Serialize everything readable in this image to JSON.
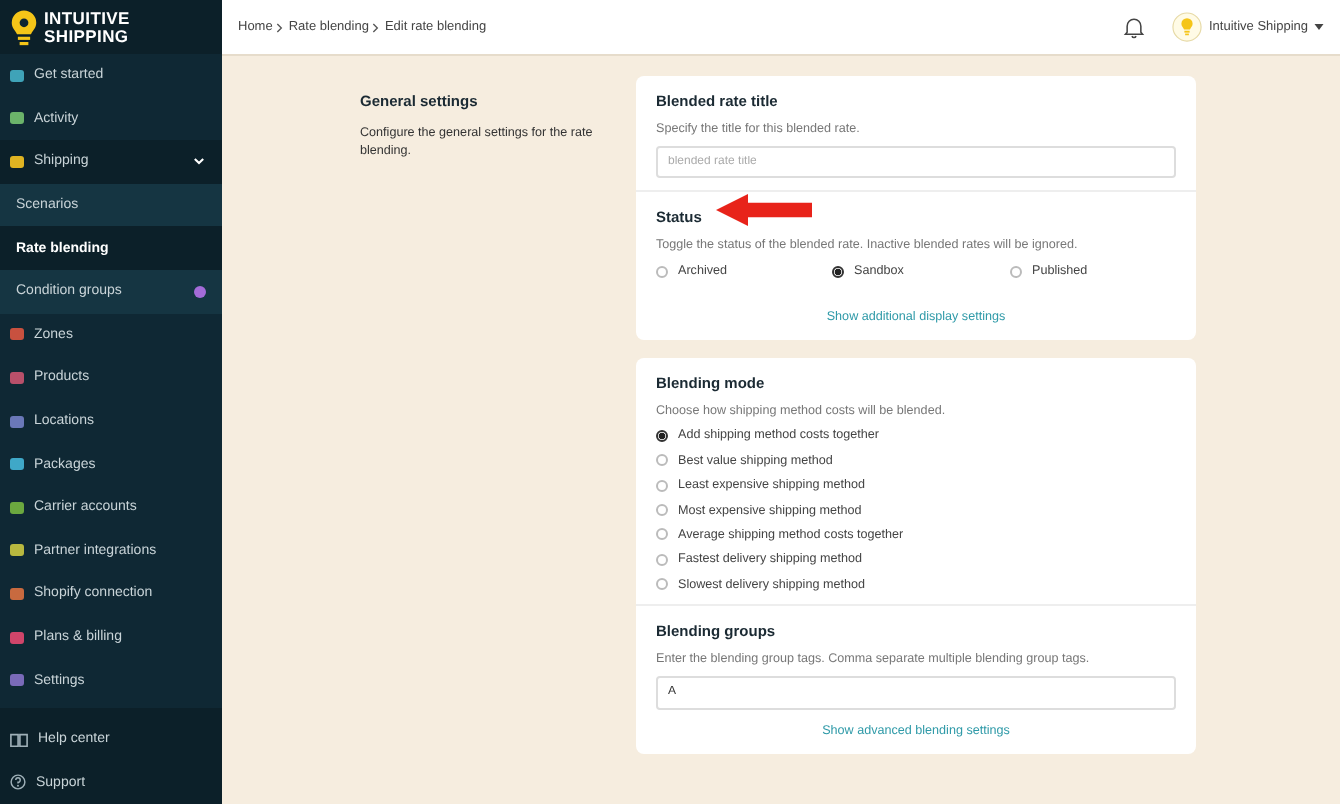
{
  "sidebar": {
    "logo": [
      "INTUITIVE",
      "SHIPPING"
    ],
    "items": [
      {
        "label": "Get started",
        "color": "#3fa3b8",
        "selected": false
      },
      {
        "label": "Activity",
        "color": "#6bb36a",
        "selected": false
      },
      {
        "label": "Shipping",
        "color": "#e0b422",
        "selected": false,
        "expanded": true,
        "children": [
          {
            "label": "Scenarios",
            "selected": false,
            "badge": false
          },
          {
            "label": "Rate blending",
            "selected": true,
            "badge": false
          },
          {
            "label": "Condition groups",
            "selected": false,
            "badge": true
          }
        ]
      },
      {
        "label": "Zones",
        "color": "#c8513f",
        "selected": false
      },
      {
        "label": "Products",
        "color": "#b8506a",
        "selected": false
      },
      {
        "label": "Locations",
        "color": "#6a78b8",
        "selected": false
      },
      {
        "label": "Packages",
        "color": "#3fa8c8",
        "selected": false
      },
      {
        "label": "Carrier accounts",
        "color": "#6ba83f",
        "selected": false
      },
      {
        "label": "Partner integrations",
        "color": "#b8b83f",
        "selected": false
      },
      {
        "label": "Shopify connection",
        "color": "#c86a3f",
        "selected": false
      },
      {
        "label": "Plans & billing",
        "color": "#d0456a",
        "selected": false
      },
      {
        "label": "Settings",
        "color": "#7a6ab8",
        "selected": false
      }
    ],
    "footer_items": [
      {
        "label": "Help center",
        "selected": false
      },
      {
        "label": "Support",
        "selected": false
      }
    ]
  },
  "breadcrumb": [
    "Home",
    "Rate blending",
    "Edit rate blending"
  ],
  "account": {
    "name": "Intuitive Shipping"
  },
  "section": {
    "title": "General settings",
    "description": "Configure the general settings for the rate blending."
  },
  "card1": {
    "title_field": {
      "title": "Blended rate title",
      "description": "Specify the title for this blended rate.",
      "placeholder": "blended rate title"
    },
    "status": {
      "title": "Status",
      "description": "Toggle the status of the blended rate. Inactive blended rates will be ignored.",
      "options": [
        {
          "label": "Archived",
          "selected": false
        },
        {
          "label": "Sandbox",
          "selected": true
        },
        {
          "label": "Published",
          "selected": false
        }
      ]
    },
    "link": "Show additional display settings"
  },
  "card2": {
    "blending_mode": {
      "title": "Blending mode",
      "description": "Choose how shipping method costs will be blended.",
      "options": [
        {
          "label": "Add shipping method costs together",
          "selected": true
        },
        {
          "label": "Best value shipping method",
          "selected": false
        },
        {
          "label": "Least expensive shipping method",
          "selected": false
        },
        {
          "label": "Most expensive shipping method",
          "selected": false
        },
        {
          "label": "Average shipping method costs together",
          "selected": false
        },
        {
          "label": "Fastest delivery shipping method",
          "selected": false
        },
        {
          "label": "Slowest delivery shipping method",
          "selected": false
        }
      ]
    },
    "blending_groups": {
      "title": "Blending groups",
      "description": "Enter the blending group tags. Comma separate multiple blending group tags.",
      "value": "A"
    },
    "link": "Show advanced blending settings"
  }
}
